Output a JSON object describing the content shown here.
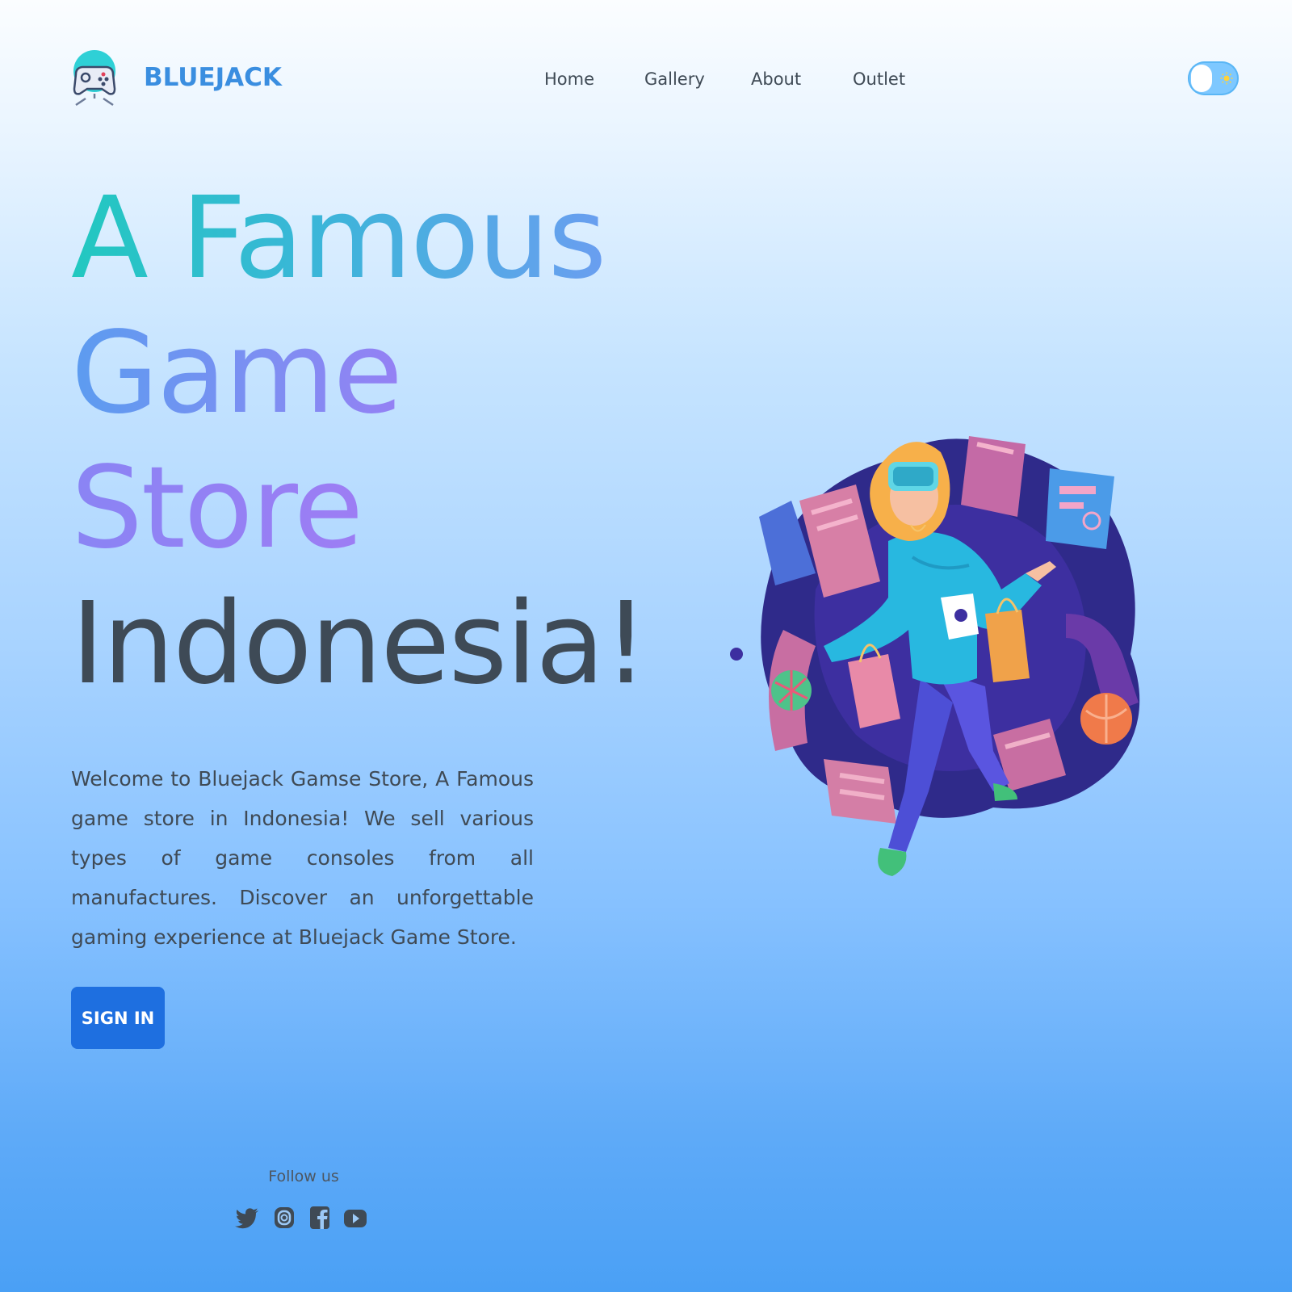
{
  "header": {
    "brand": "BLUEJACK",
    "logo_icon": "gamepad-mascot-icon",
    "nav": [
      {
        "label": "Home"
      },
      {
        "label": "Gallery"
      },
      {
        "label": "About"
      },
      {
        "label": "Outlet"
      }
    ],
    "theme_toggle": {
      "state": "light",
      "icon": "sun-icon"
    }
  },
  "hero": {
    "title_lines": [
      "A Famous",
      "Game",
      "Store",
      "Indonesia!"
    ],
    "description": "Welcome to Bluejack Gamse Store, A Famous game store in Indonesia! We sell various types of game consoles from all manufactures. Discover an unforgettable gaming experience at Bluejack Game Store.",
    "cta_label": "SIGN IN",
    "illustration_icon": "vr-shopping-illustration"
  },
  "follow": {
    "label": "Follow us",
    "socials": [
      "twitter-icon",
      "instagram-icon",
      "facebook-icon",
      "youtube-icon"
    ]
  },
  "colors": {
    "brand": "#3a8ee0",
    "button": "#1e6fe0",
    "text": "#3f4a55"
  }
}
